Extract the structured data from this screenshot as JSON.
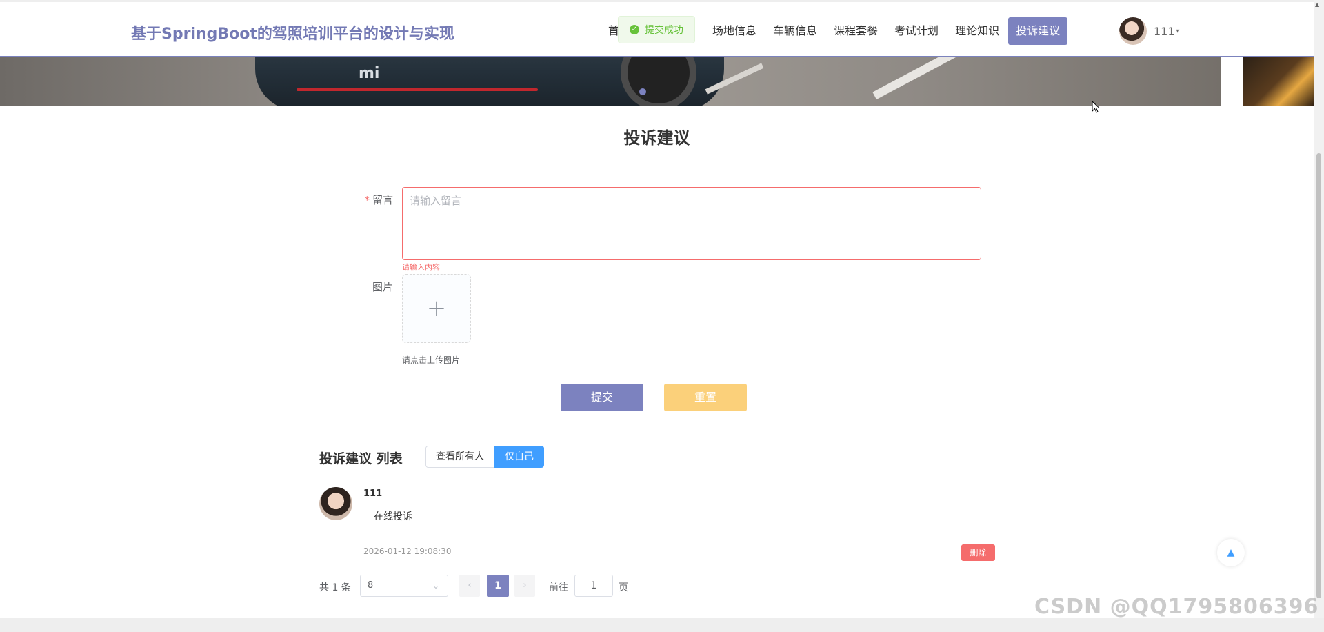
{
  "header": {
    "brand": "基于SpringBoot的驾照培训平台的设计与实现",
    "nav": [
      {
        "label": "首",
        "active": false
      },
      {
        "label": "场地信息",
        "active": false
      },
      {
        "label": "车辆信息",
        "active": false
      },
      {
        "label": "课程套餐",
        "active": false
      },
      {
        "label": "考试计划",
        "active": false
      },
      {
        "label": "理论知识",
        "active": false
      },
      {
        "label": "投诉建议",
        "active": true
      }
    ],
    "toast": "提交成功",
    "user": {
      "name": "111",
      "caret": "▾"
    }
  },
  "banner": {
    "badge": "mi"
  },
  "page": {
    "title": "投诉建议"
  },
  "form": {
    "message": {
      "required_mark": "*",
      "label": "留言",
      "placeholder": "请输入留言",
      "value": "",
      "error": "请输入内容"
    },
    "image": {
      "label": "图片",
      "upload_icon": "+",
      "tip": "请点击上传图片"
    },
    "submit": "提交",
    "reset": "重置"
  },
  "list": {
    "title": "投诉建议 列表",
    "filters": [
      {
        "label": "查看所有人",
        "active": false
      },
      {
        "label": "仅自己",
        "active": true
      }
    ],
    "items": [
      {
        "user": "111",
        "content": "在线投诉",
        "time": "2026-01-12 19:08:30",
        "delete": "删除"
      }
    ]
  },
  "pagination": {
    "total": "共 1 条",
    "page_size": "8",
    "prev": "‹",
    "current": "1",
    "next": "›",
    "goto_label": "前往",
    "goto_value": "1",
    "page_suffix": "页"
  },
  "backtop": "▲",
  "watermark": "CSDN @QQ1795806396",
  "colors": {
    "accent": "#7c82bf",
    "reset": "#fbd07a",
    "danger": "#f56c6c",
    "success": "#67c23a",
    "primary": "#409eff"
  },
  "icons": [
    "check-circle-icon",
    "caret-down-icon",
    "plus-icon",
    "chevron-down-icon",
    "chevron-left-icon",
    "chevron-right-icon",
    "arrow-up-icon",
    "cursor-icon"
  ]
}
